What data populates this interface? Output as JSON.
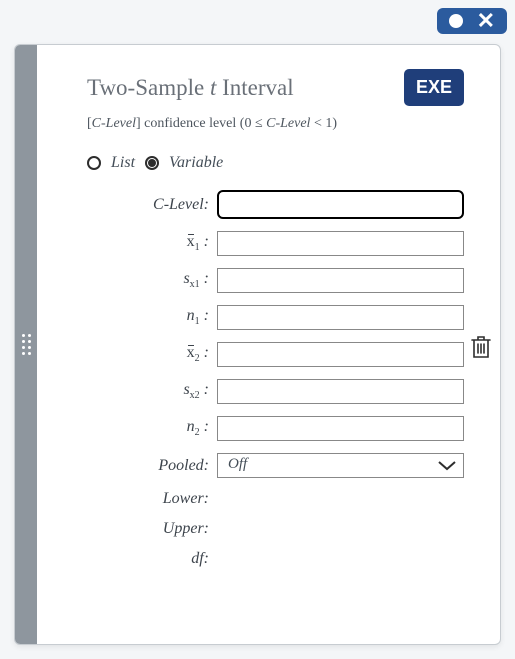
{
  "titlebar": {
    "circle_name": "status-dot",
    "close_name": "close"
  },
  "header": {
    "title_pre": "Two-Sample ",
    "title_ital": "t",
    "title_post": " Interval",
    "exe_label": "EXE"
  },
  "subtitle": {
    "text_pre": "[",
    "clevel": "C-Level",
    "text_mid": "] confidence level (0 ≤ ",
    "clevel2": "C-Level",
    "text_post": " < 1)"
  },
  "mode": {
    "option_list": "List",
    "option_variable": "Variable",
    "selected": "Variable"
  },
  "fields": {
    "clevel": {
      "label": "C-Level:",
      "value": ""
    },
    "xbar1": {
      "label_base": "x",
      "label_sub": "1",
      "value": ""
    },
    "sx1": {
      "label_base": "s",
      "label_x": "x",
      "label_sub": "1",
      "value": ""
    },
    "n1": {
      "label_base": "n",
      "label_sub": "1",
      "value": ""
    },
    "xbar2": {
      "label_base": "x",
      "label_sub": "2",
      "value": ""
    },
    "sx2": {
      "label_base": "s",
      "label_x": "x",
      "label_sub": "2",
      "value": ""
    },
    "n2": {
      "label_base": "n",
      "label_sub": "2",
      "value": ""
    },
    "pooled": {
      "label": "Pooled:",
      "value": "Off"
    }
  },
  "outputs": {
    "lower": {
      "label": "Lower:",
      "value": ""
    },
    "upper": {
      "label": "Upper:",
      "value": ""
    },
    "df": {
      "label": "df:",
      "value": ""
    }
  }
}
